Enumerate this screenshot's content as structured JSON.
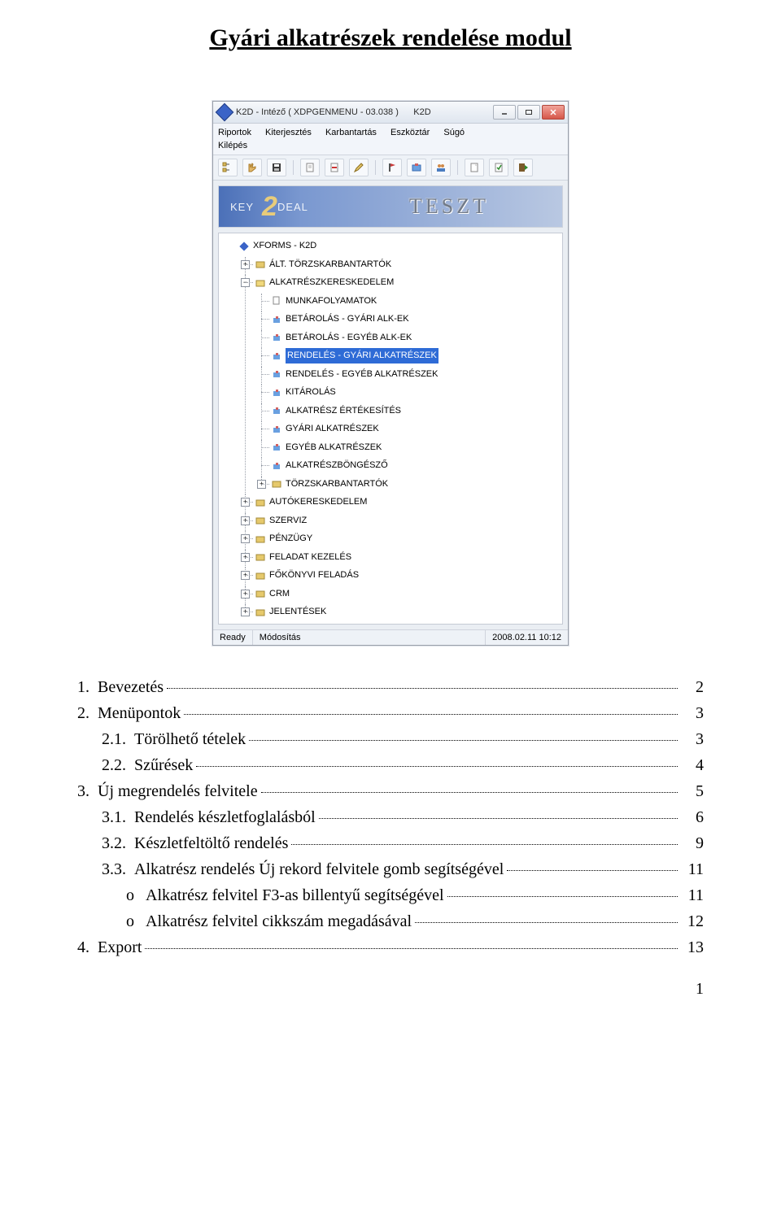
{
  "doc_title": "Gyári alkatrészek rendelése modul",
  "page_number": "1",
  "window": {
    "title_left": "K2D - Intéző ( XDPGENMENU - 03.038 )",
    "title_right": "K2D",
    "menus": [
      "Riportok",
      "Kiterjesztés",
      "Karbantartás",
      "Eszköztár",
      "Súgó",
      "Kilépés"
    ],
    "banner_brand_left": "KEY",
    "banner_brand_mid": "2",
    "banner_brand_right": "DEAL",
    "banner_text": "TESZT",
    "status": {
      "ready": "Ready",
      "mode": "Módosítás",
      "timestamp": "2008.02.11 10:12"
    },
    "tree": {
      "root": "XFORMS - K2D",
      "n0": "ÁLT. TÖRZSKARBANTARTÓK",
      "n1": "ALKATRÉSZKERESKEDELEM",
      "n1_0": "MUNKAFOLYAMATOK",
      "n1_1": "BETÁROLÁS - GYÁRI ALK-EK",
      "n1_2": "BETÁROLÁS - EGYÉB ALK-EK",
      "n1_3": "RENDELÉS - GYÁRI ALKATRÉSZEK",
      "n1_4": "RENDELÉS - EGYÉB ALKATRÉSZEK",
      "n1_5": "KITÁROLÁS",
      "n1_6": "ALKATRÉSZ ÉRTÉKESÍTÉS",
      "n1_7": "GYÁRI ALKATRÉSZEK",
      "n1_8": "EGYÉB ALKATRÉSZEK",
      "n1_9": "ALKATRÉSZBÖNGÉSZŐ",
      "n1_10": "TÖRZSKARBANTARTÓK",
      "n2": "AUTÓKERESKEDELEM",
      "n3": "SZERVIZ",
      "n4": "PÉNZÜGY",
      "n5": "FELADAT KEZELÉS",
      "n6": "FŐKÖNYVI FELADÁS",
      "n7": "CRM",
      "n8": "JELENTÉSEK"
    }
  },
  "toc": {
    "r0_label": "Bevezetés",
    "r0_num": "1.",
    "r0_pg": "2",
    "r1_label": "Menüpontok",
    "r1_num": "2.",
    "r1_pg": "3",
    "r2_label": "Törölhető tételek",
    "r2_num": "2.1.",
    "r2_pg": "3",
    "r3_label": "Szűrések",
    "r3_num": "2.2.",
    "r3_pg": "4",
    "r4_label": "Új megrendelés felvitele",
    "r4_num": "3.",
    "r4_pg": "5",
    "r5_label": "Rendelés készletfoglalásból",
    "r5_num": "3.1.",
    "r5_pg": "6",
    "r6_label": "Készletfeltöltő rendelés",
    "r6_num": "3.2.",
    "r6_pg": "9",
    "r7_label": "Alkatrész rendelés Új rekord felvitele gomb segítségével",
    "r7_num": "3.3.",
    "r7_pg": "11",
    "r8_label": "Alkatrész felvitel F3-as billentyű segítségével",
    "r8_bullet": "o",
    "r8_pg": "11",
    "r9_label": "Alkatrész felvitel cikkszám megadásával",
    "r9_bullet": "o",
    "r9_pg": "12",
    "r10_label": "Export",
    "r10_num": "4.",
    "r10_pg": "13"
  }
}
